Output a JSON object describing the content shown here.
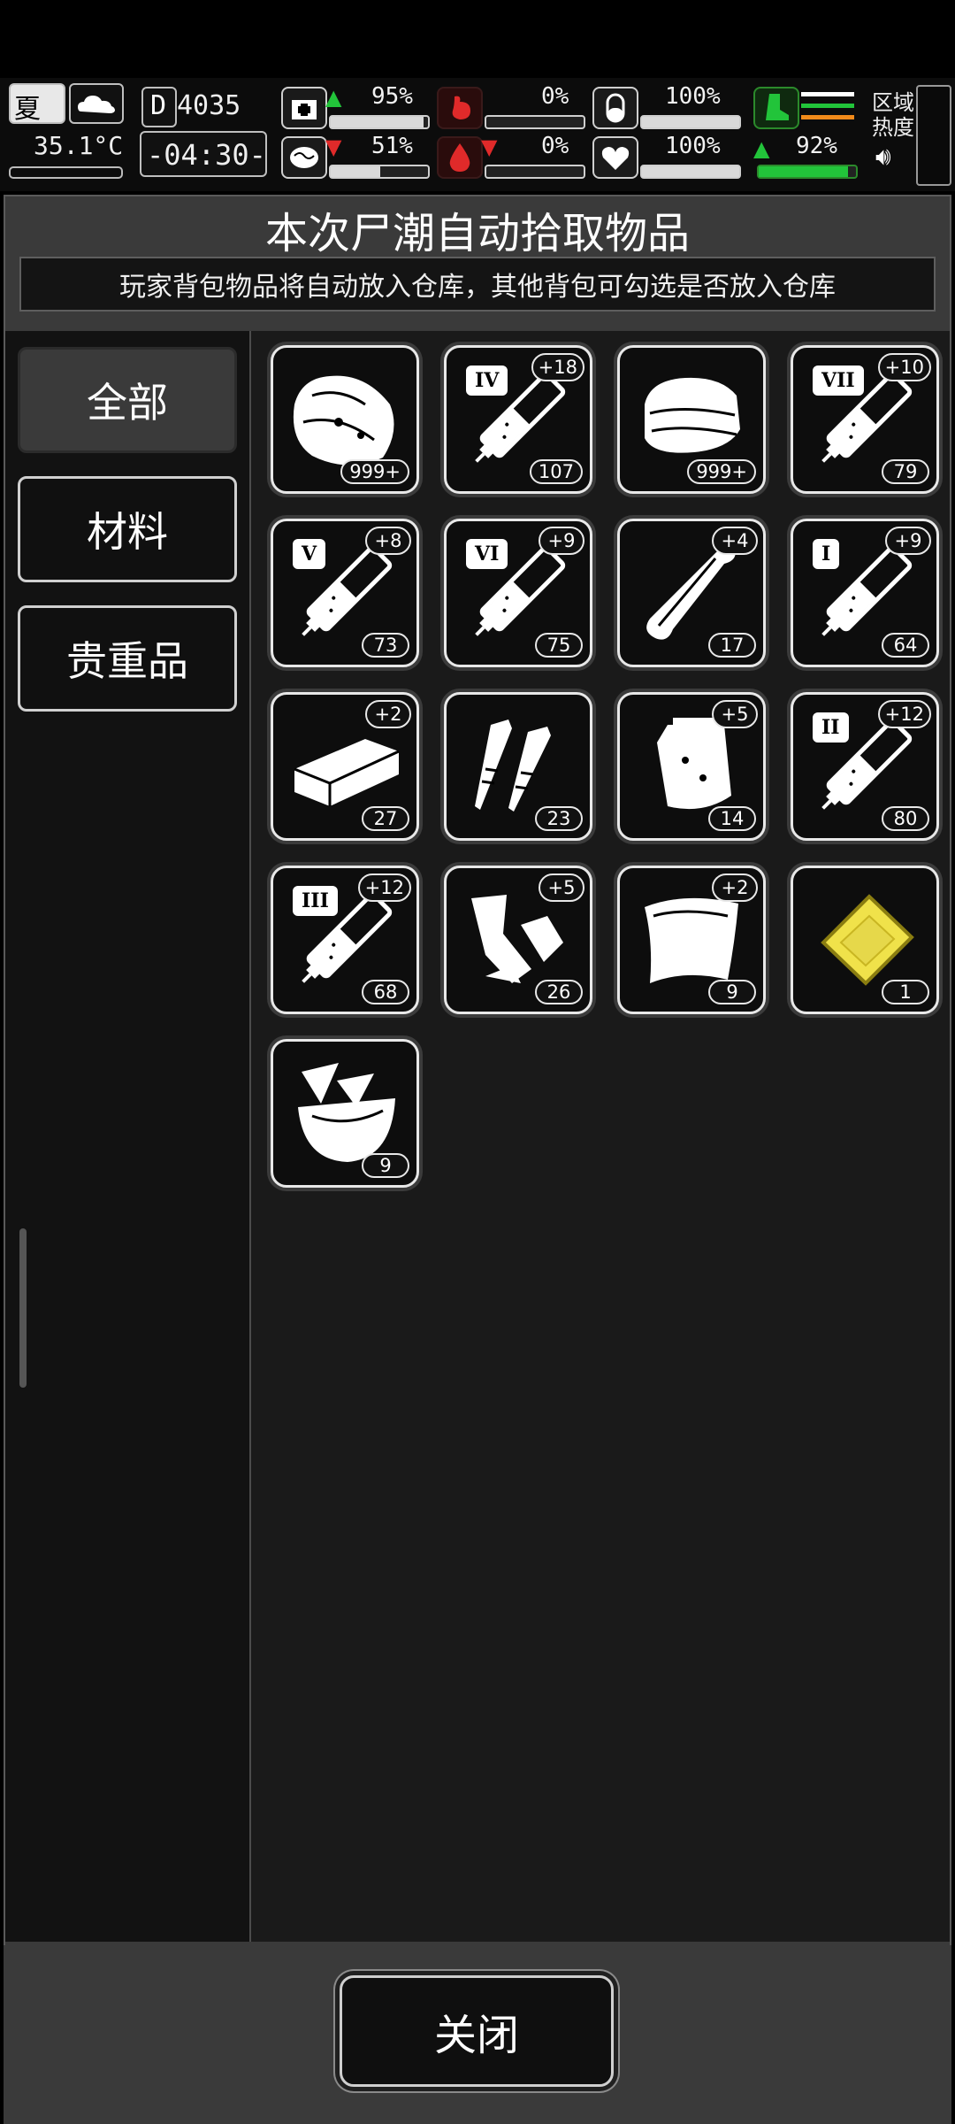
{
  "status_bar": {
    "season": "夏",
    "temperature": "35.1°C",
    "day_counter": "4035",
    "time": "-04:30-",
    "zone_heat_label": "区域\n热度",
    "stats": [
      {
        "id": "health",
        "value": "95%",
        "fill": 0.95,
        "trend": "up"
      },
      {
        "id": "hunger",
        "value": "0%",
        "fill": 0.0,
        "trend": "none"
      },
      {
        "id": "stamina",
        "value": "100%",
        "fill": 1.0,
        "trend": "none"
      },
      {
        "id": "sanity",
        "value": "51%",
        "fill": 0.51,
        "trend": "down"
      },
      {
        "id": "thirst",
        "value": "0%",
        "fill": 0.0,
        "trend": "down"
      },
      {
        "id": "heart",
        "value": "100%",
        "fill": 1.0,
        "trend": "none"
      },
      {
        "id": "speed",
        "value": "92%",
        "fill": 0.92,
        "trend": "up"
      }
    ],
    "colors": {
      "green": "#22c43a",
      "red": "#e02a2a",
      "orange": "#f28a1a"
    }
  },
  "panel": {
    "title": "本次尸潮自动拾取物品",
    "subtitle": "玩家背包物品将自动放入仓库，其他背包可勾选是否放入仓库"
  },
  "tabs": [
    {
      "label": "全部",
      "active": true
    },
    {
      "label": "材料",
      "active": false
    },
    {
      "label": "贵重品",
      "active": false
    }
  ],
  "items": [
    {
      "icon": "meat-chunk-icon",
      "count": "999+",
      "plus": ""
    },
    {
      "icon": "syringe-icon",
      "roman": "IV",
      "count": "107",
      "plus": "+18"
    },
    {
      "icon": "cloth-icon",
      "count": "999+",
      "plus": ""
    },
    {
      "icon": "syringe-icon",
      "roman": "VII",
      "count": "79",
      "plus": "+10"
    },
    {
      "icon": "syringe-icon",
      "roman": "V",
      "count": "73",
      "plus": "+8"
    },
    {
      "icon": "syringe-icon",
      "roman": "VI",
      "count": "75",
      "plus": "+9"
    },
    {
      "icon": "bone-icon",
      "count": "17",
      "plus": "+4"
    },
    {
      "icon": "syringe-icon",
      "roman": "I",
      "count": "64",
      "plus": "+9"
    },
    {
      "icon": "plank-icon",
      "count": "27",
      "plus": "+2"
    },
    {
      "icon": "nails-icon",
      "count": "23",
      "plus": ""
    },
    {
      "icon": "medicine-bag-icon",
      "count": "14",
      "plus": "+5"
    },
    {
      "icon": "syringe-icon",
      "roman": "II",
      "count": "80",
      "plus": "+12"
    },
    {
      "icon": "syringe-icon",
      "roman": "III",
      "count": "68",
      "plus": "+12"
    },
    {
      "icon": "scrap-metal-icon",
      "count": "26",
      "plus": "+5"
    },
    {
      "icon": "leather-sheet-icon",
      "count": "9",
      "plus": "+2"
    },
    {
      "icon": "gold-bar-icon",
      "count": "1",
      "plus": "",
      "color": "#e6d84a"
    },
    {
      "icon": "bowl-shards-icon",
      "count": "9",
      "plus": ""
    }
  ],
  "footer": {
    "close_label": "关闭"
  }
}
